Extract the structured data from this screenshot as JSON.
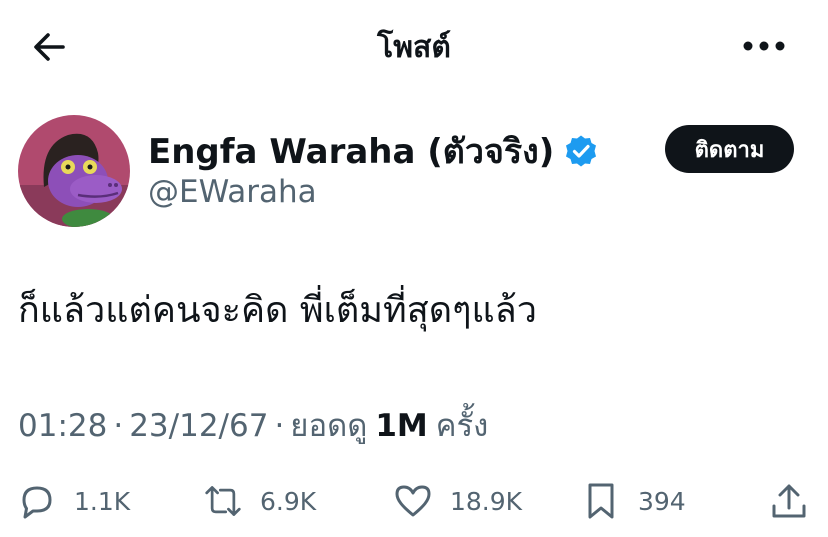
{
  "header": {
    "title": "โพสต์",
    "back_icon": "arrow-left-icon",
    "more_icon": "more-horizontal-icon"
  },
  "author": {
    "name": "Engfa Waraha (ตัวจริง)",
    "handle": "@EWaraha",
    "verified": true,
    "verified_color": "#1d9bf0",
    "follow_label": "ติดตาม"
  },
  "tweet": {
    "text": "ก็แล้วแต่คนจะคิด พี่เต็มที่สุดๆแล้ว"
  },
  "meta": {
    "time": "01:28",
    "date": "23/12/67",
    "views_label": "ยอดดู",
    "views_count": "1M",
    "views_suffix": "ครั้ง"
  },
  "actions": {
    "replies": "1.1K",
    "reposts": "6.9K",
    "likes": "18.9K",
    "bookmarks": "394"
  },
  "colors": {
    "text": "#0f1419",
    "secondary": "#536471",
    "button": "#0f1419"
  }
}
